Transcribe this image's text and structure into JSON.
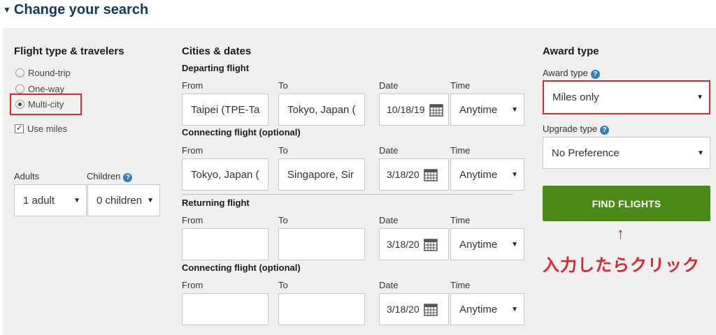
{
  "header": {
    "toggle_icon": "caret-down-icon",
    "title": "Change your search"
  },
  "flight_type": {
    "title": "Flight type & travelers",
    "options": [
      {
        "label": "Round-trip",
        "selected": false
      },
      {
        "label": "One-way",
        "selected": false
      },
      {
        "label": "Multi-city",
        "selected": true
      }
    ],
    "use_miles": {
      "label": "Use miles",
      "checked": true
    }
  },
  "travelers": {
    "adults_label": "Adults",
    "adults_value": "1 adult",
    "children_label": "Children",
    "children_value": "0 children"
  },
  "cities": {
    "title": "Cities & dates",
    "labels": {
      "from": "From",
      "to": "To",
      "date": "Date",
      "time": "Time"
    },
    "segments": [
      {
        "title": "Departing flight",
        "from": "Taipei (TPE-Ta",
        "to": "Tokyo, Japan (",
        "date": "10/18/19",
        "time": "Anytime"
      },
      {
        "title": "Connecting flight (optional)",
        "from": "Tokyo, Japan (",
        "to": "Singapore, Sir",
        "date": "3/18/20",
        "time": "Anytime"
      },
      {
        "title": "Returning flight",
        "from": "",
        "to": "",
        "date": "3/18/20",
        "time": "Anytime"
      },
      {
        "title": "Connecting flight (optional)",
        "from": "",
        "to": "",
        "date": "3/18/20",
        "time": "Anytime"
      }
    ]
  },
  "award": {
    "title": "Award type",
    "award_type_label": "Award type",
    "award_type_value": "Miles only",
    "upgrade_type_label": "Upgrade type",
    "upgrade_type_value": "No Preference",
    "find_button": "FIND FLIGHTS",
    "arrow": "↑",
    "note": "入力したらクリック"
  },
  "colors": {
    "accent": "#0f3a63",
    "button": "#4b8a18",
    "highlight": "#d9262f",
    "help": "#2f7fbf"
  }
}
